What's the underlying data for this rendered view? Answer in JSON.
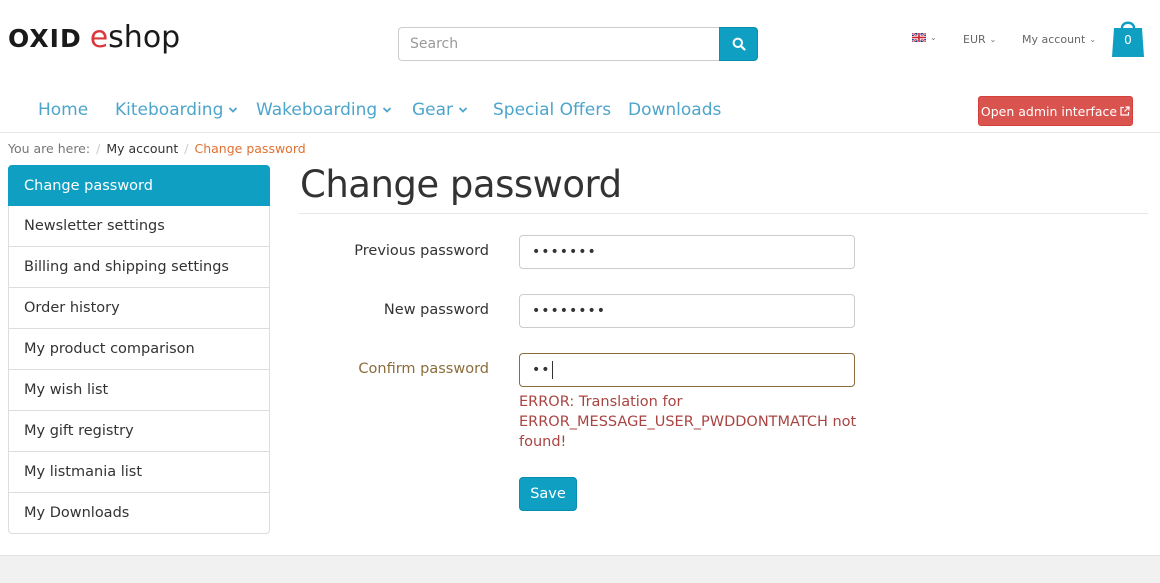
{
  "header": {
    "logo_oxid": "OXID",
    "logo_e": "e",
    "logo_shop": "shop",
    "search_placeholder": "Search",
    "currency": "EUR",
    "account": "My account",
    "cart_count": "0",
    "language_icon": "uk-flag-icon"
  },
  "nav": {
    "items": [
      {
        "label": "Home",
        "dropdown": false
      },
      {
        "label": "Kiteboarding",
        "dropdown": true
      },
      {
        "label": "Wakeboarding",
        "dropdown": true
      },
      {
        "label": "Gear",
        "dropdown": true
      },
      {
        "label": "Special Offers",
        "dropdown": false
      },
      {
        "label": "Downloads",
        "dropdown": false
      }
    ],
    "admin_button": "Open admin interface"
  },
  "breadcrumb": {
    "prefix": "You are here:",
    "items": [
      "My account",
      "Change password"
    ]
  },
  "sidebar": {
    "items": [
      {
        "label": "Change password",
        "active": true
      },
      {
        "label": "Newsletter settings"
      },
      {
        "label": "Billing and shipping settings"
      },
      {
        "label": "Order history"
      },
      {
        "label": "My product comparison"
      },
      {
        "label": "My wish list"
      },
      {
        "label": "My gift registry"
      },
      {
        "label": "My listmania list"
      },
      {
        "label": "My Downloads"
      }
    ]
  },
  "main": {
    "title": "Change password",
    "fields": [
      {
        "label": "Previous password",
        "value": "•••••••"
      },
      {
        "label": "New password",
        "value": "••••••••"
      },
      {
        "label": "Confirm password",
        "value": "••",
        "error": true
      }
    ],
    "error_message": "ERROR: Translation for ERROR_MESSAGE_USER_PWDDONTMATCH not found!",
    "save_label": "Save"
  },
  "colors": {
    "accent": "#0e9fc3",
    "nav_link": "#4da5cc",
    "admin_button": "#d9534f",
    "breadcrumb_active": "#e2702f",
    "error_text": "#a94442",
    "warning_label": "#8a6d3b"
  }
}
